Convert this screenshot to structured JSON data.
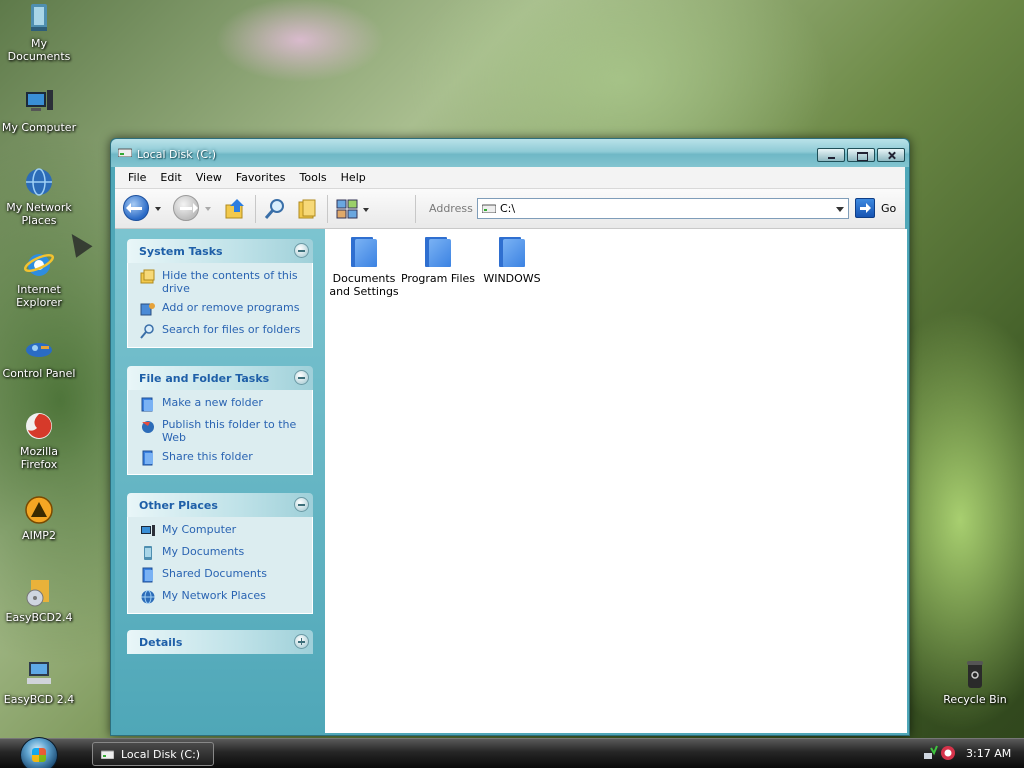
{
  "desktop": {
    "icons": [
      {
        "label": "My Documents",
        "icon": "my-documents-icon"
      },
      {
        "label": "My Computer",
        "icon": "my-computer-icon"
      },
      {
        "label": "My Network Places",
        "icon": "network-places-icon"
      },
      {
        "label": "Internet Explorer",
        "icon": "internet-explorer-icon"
      },
      {
        "label": "Control Panel",
        "icon": "control-panel-icon"
      },
      {
        "label": "Mozilla Firefox",
        "icon": "firefox-icon"
      },
      {
        "label": "AIMP2",
        "icon": "aimp2-icon"
      },
      {
        "label": "EasyBCD2.4",
        "icon": "easybcd-icon"
      },
      {
        "label": "EasyBCD 2.4",
        "icon": "easybcd-shortcut-icon"
      },
      {
        "label": "Recycle Bin",
        "icon": "recycle-bin-icon"
      }
    ]
  },
  "window": {
    "title": "Local Disk (C:)",
    "menu": [
      "File",
      "Edit",
      "View",
      "Favorites",
      "Tools",
      "Help"
    ],
    "address_label": "Address",
    "address_value": "C:\\",
    "go_label": "Go"
  },
  "tasks": {
    "system": {
      "title": "System Tasks",
      "items": [
        "Hide the contents of this drive",
        "Add or remove programs",
        "Search for files or folders"
      ]
    },
    "file_folder": {
      "title": "File and Folder Tasks",
      "items": [
        "Make a new folder",
        "Publish this folder to the Web",
        "Share this folder"
      ]
    },
    "other_places": {
      "title": "Other Places",
      "items": [
        "My Computer",
        "My Documents",
        "Shared Documents",
        "My Network Places"
      ]
    },
    "details": {
      "title": "Details"
    }
  },
  "content": {
    "folders": [
      "Documents and Settings",
      "Program Files",
      "WINDOWS"
    ]
  },
  "taskbar": {
    "task_button": "Local Disk (C:)",
    "clock": "3:17 AM"
  },
  "colors": {
    "window_frame": "#4fa7b8",
    "link_blue": "#2a64b2",
    "folder_blue": "#3b82e2"
  }
}
